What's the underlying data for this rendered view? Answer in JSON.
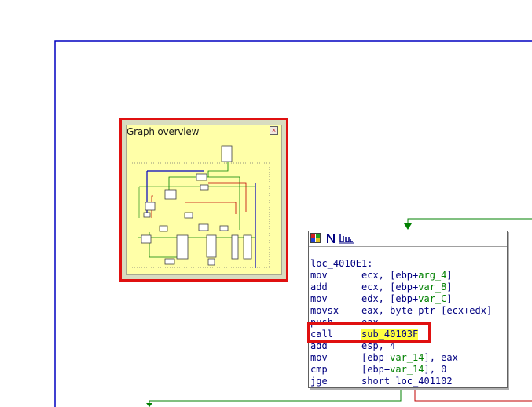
{
  "overview": {
    "title": "Graph overview",
    "close_glyph": "×"
  },
  "node": {
    "header_icons": [
      "color-palette-icon",
      "rename-icon",
      "graph-icon"
    ],
    "label": "loc_4010E1:",
    "lines": [
      {
        "mnem": "mov",
        "ops": [
          {
            "t": "ecx, [ebp+"
          },
          {
            "t": "arg_4",
            "c": "var"
          },
          {
            "t": "]"
          }
        ]
      },
      {
        "mnem": "add",
        "ops": [
          {
            "t": "ecx, [ebp+"
          },
          {
            "t": "var_8",
            "c": "var"
          },
          {
            "t": "]"
          }
        ]
      },
      {
        "mnem": "mov",
        "ops": [
          {
            "t": "edx, [ebp+"
          },
          {
            "t": "var_C",
            "c": "var"
          },
          {
            "t": "]"
          }
        ]
      },
      {
        "mnem": "movsx",
        "ops": [
          {
            "t": "eax, byte ptr [ecx+edx]"
          }
        ]
      },
      {
        "mnem": "push",
        "ops": [
          {
            "t": "eax"
          }
        ]
      },
      {
        "mnem": "call",
        "ops": [
          {
            "t": "sub_40103F",
            "c": "hl"
          }
        ]
      },
      {
        "mnem": "add",
        "ops": [
          {
            "t": "esp, 4"
          }
        ]
      },
      {
        "mnem": "mov",
        "ops": [
          {
            "t": "[ebp+"
          },
          {
            "t": "var_14",
            "c": "var"
          },
          {
            "t": "], eax"
          }
        ]
      },
      {
        "mnem": "cmp",
        "ops": [
          {
            "t": "[ebp+"
          },
          {
            "t": "var_14",
            "c": "var"
          },
          {
            "t": "], 0"
          }
        ]
      },
      {
        "mnem": "jge",
        "ops": [
          {
            "t": "short loc_401102"
          }
        ]
      }
    ]
  },
  "colors": {
    "frame_blue": "#0000c0",
    "edge_green": "#008000",
    "edge_red": "#c00000",
    "highlight_red": "#e01010",
    "overview_bg": "#ffffa8",
    "call_highlight": "#ffff40"
  }
}
